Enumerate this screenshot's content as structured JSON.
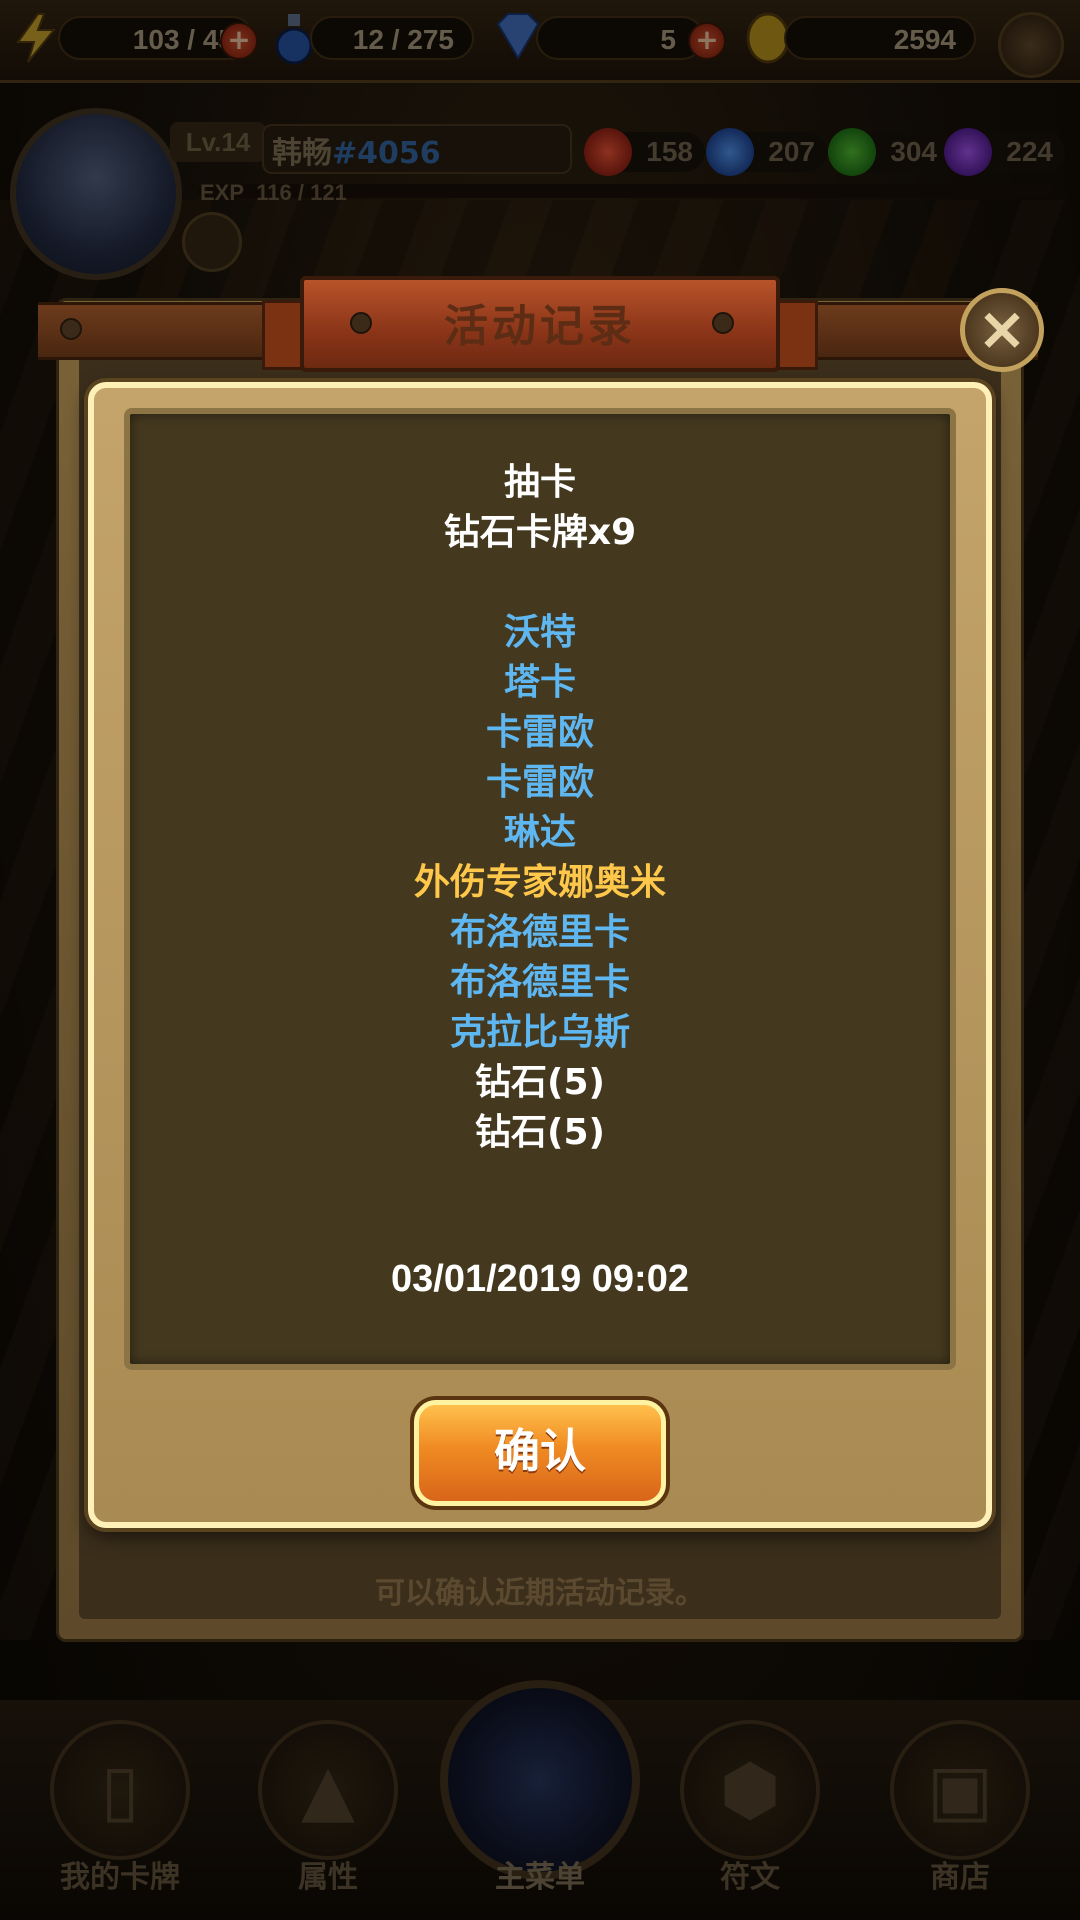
{
  "topbar": {
    "energy": "103 / 45",
    "potion": "12 / 275",
    "diamond": "5",
    "gold": "2594"
  },
  "profile": {
    "level": "Lv.14",
    "name": "韩畅",
    "tag": "#4056",
    "exp_label": "EXP",
    "exp_value": "116 / 121",
    "gems": {
      "red": "158",
      "blue": "207",
      "green": "304",
      "purple": "224"
    }
  },
  "dialog": {
    "title": "活动记录",
    "header_line1": "抽卡",
    "header_line2": "钻石卡牌x9",
    "results": [
      {
        "text": "沃特",
        "rarity": "blue"
      },
      {
        "text": "塔卡",
        "rarity": "blue"
      },
      {
        "text": "卡雷欧",
        "rarity": "blue"
      },
      {
        "text": "卡雷欧",
        "rarity": "blue"
      },
      {
        "text": "琳达",
        "rarity": "blue"
      },
      {
        "text": "外伤专家娜奥米",
        "rarity": "gold"
      },
      {
        "text": "布洛德里卡",
        "rarity": "blue"
      },
      {
        "text": "布洛德里卡",
        "rarity": "blue"
      },
      {
        "text": "克拉比乌斯",
        "rarity": "blue"
      },
      {
        "text": "钻石(5)",
        "rarity": "white"
      },
      {
        "text": "钻石(5)",
        "rarity": "white"
      }
    ],
    "datetime": "03/01/2019 09:02",
    "confirm_label": "确认",
    "close_icon": "×"
  },
  "panel_footer": "可以确认近期活动记录。",
  "nav": {
    "items": [
      {
        "label": "我的卡牌",
        "icon": "cards-icon"
      },
      {
        "label": "属性",
        "icon": "triangle-icon"
      },
      {
        "label": "主菜单",
        "icon": "emblem-icon"
      },
      {
        "label": "符文",
        "icon": "rune-stone-icon"
      },
      {
        "label": "商店",
        "icon": "treasure-chest-icon"
      }
    ]
  },
  "colors": {
    "blue_rarity": "#5fb7f2",
    "gold_rarity": "#ffc84a",
    "white_text": "#ffffff",
    "confirm_orange": "#f08a22"
  }
}
